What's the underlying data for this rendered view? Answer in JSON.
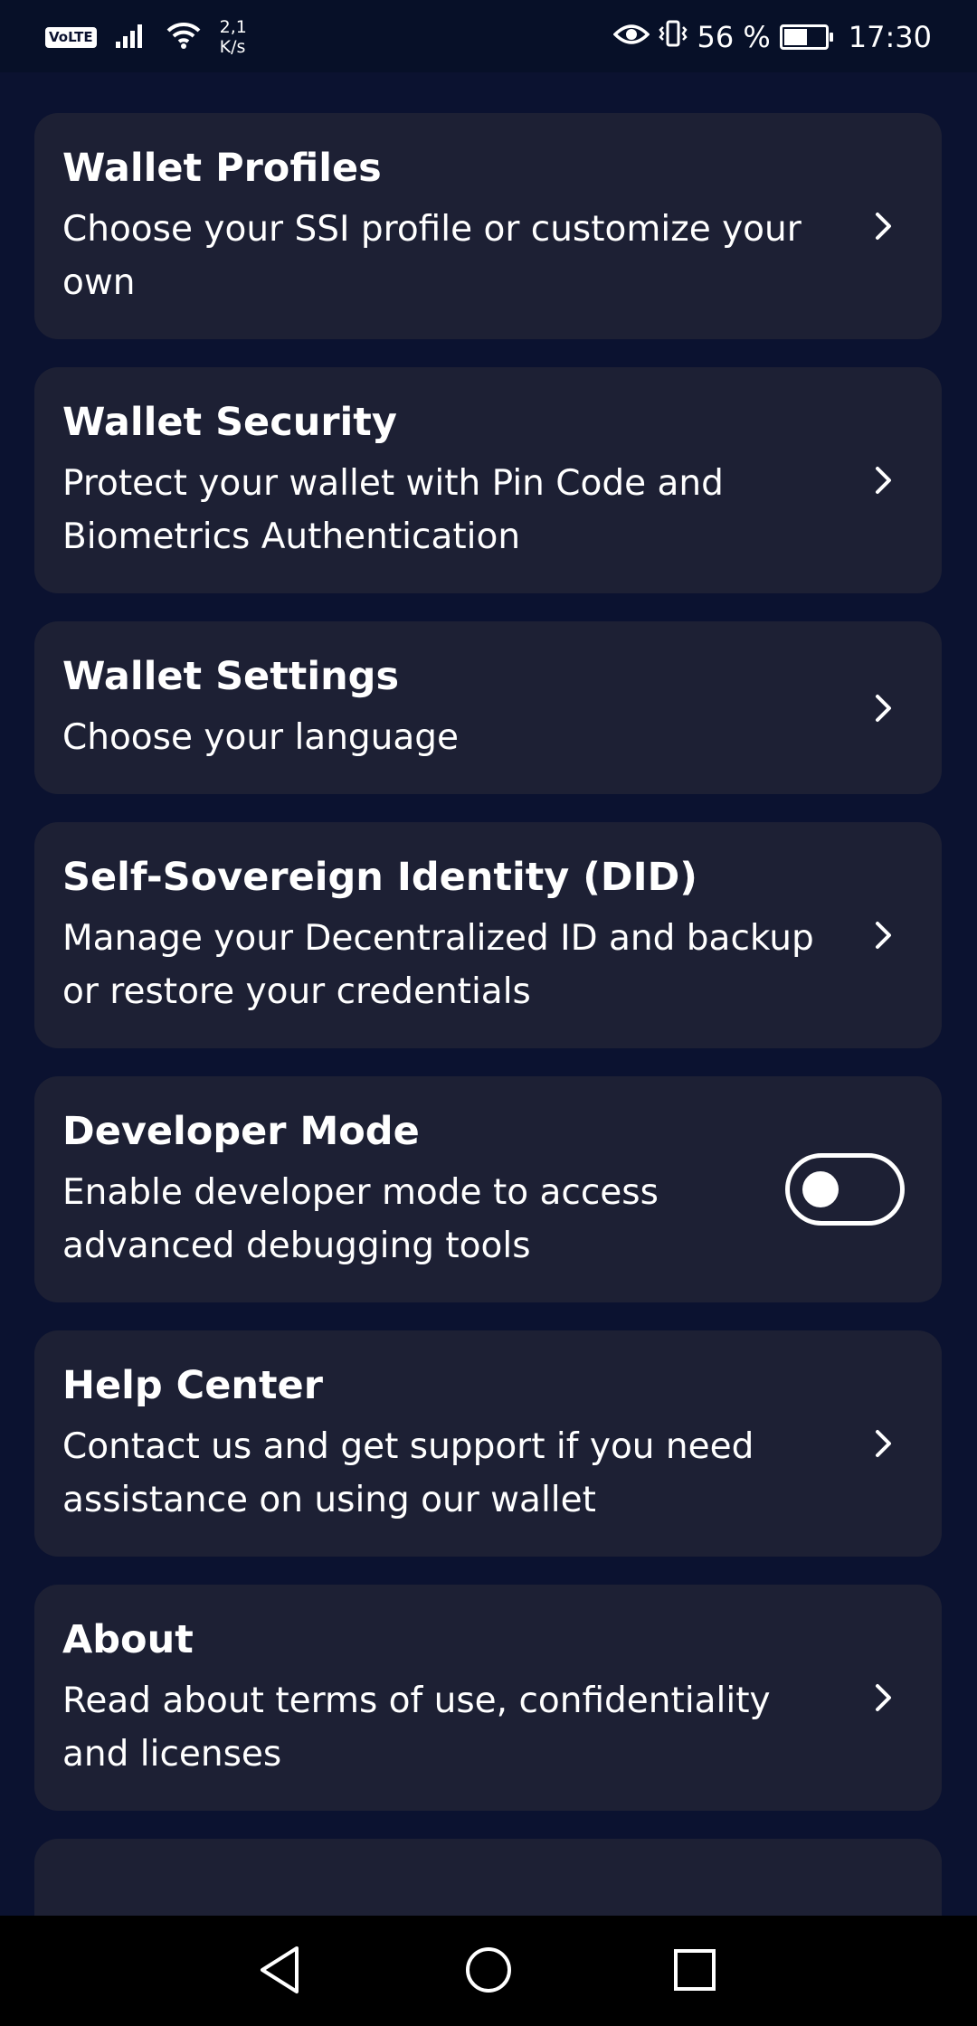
{
  "status_bar": {
    "volte": "VoLTE",
    "net_speed_value": "2,1",
    "net_speed_unit": "K/s",
    "battery_percent": "56 %",
    "battery_level": 0.56,
    "time": "17:30",
    "icons": [
      "signal-icon",
      "wifi-icon",
      "eye-icon",
      "vibrate-icon",
      "battery-charging-icon"
    ]
  },
  "settings": {
    "items": [
      {
        "title": "Wallet Profiles",
        "description": "Choose your SSI profile or customize your own",
        "control": "chevron"
      },
      {
        "title": "Wallet Security",
        "description": "Protect your wallet with Pin Code and Biometrics Authentication",
        "control": "chevron"
      },
      {
        "title": "Wallet Settings",
        "description": "Choose your language",
        "control": "chevron"
      },
      {
        "title": "Self-Sovereign Identity (DID)",
        "description": "Manage your Decentralized ID and backup or restore your credentials",
        "control": "chevron"
      },
      {
        "title": "Developer Mode",
        "description": "Enable developer mode to access advanced debugging tools",
        "control": "toggle",
        "toggle_on": false
      },
      {
        "title": "Help Center",
        "description": "Contact us and get support if you need assistance on using our wallet",
        "control": "chevron"
      },
      {
        "title": "About",
        "description": "Read about terms of use, confidentiality and licenses",
        "control": "chevron"
      }
    ]
  },
  "nav_bar": {
    "buttons": [
      "back-icon",
      "home-icon",
      "recents-icon"
    ]
  },
  "colors": {
    "background": "#0b1230",
    "card": "#1d2034",
    "text": "#ffffff",
    "nav_bar": "#000000"
  }
}
